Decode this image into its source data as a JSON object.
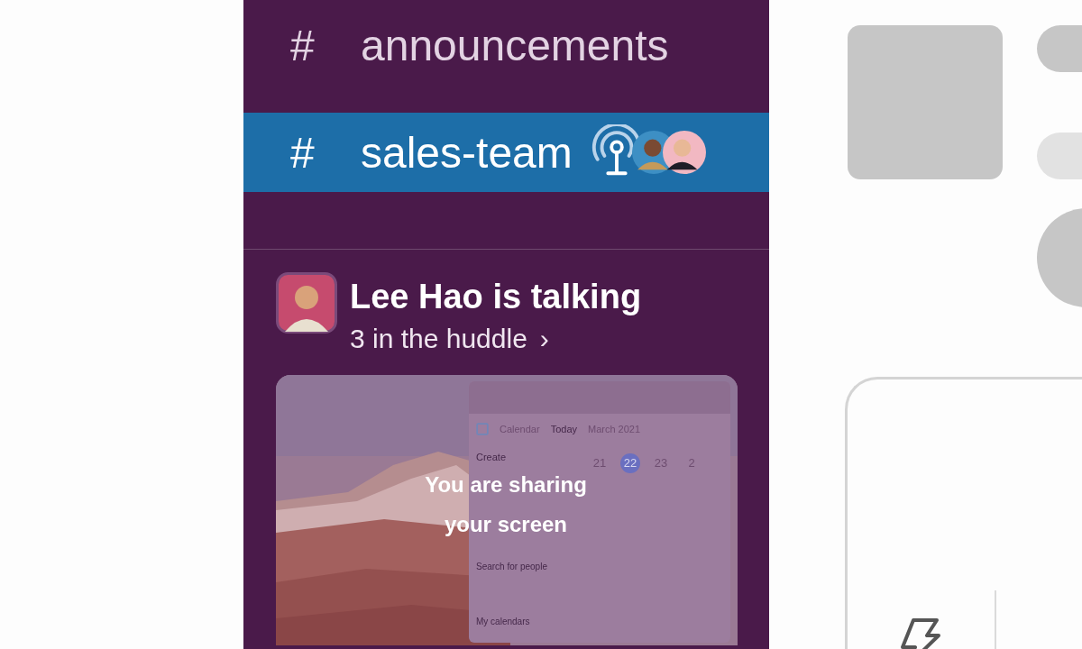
{
  "channels": [
    {
      "prefix": "#",
      "name": "announcements",
      "selected": false,
      "huddle": false
    },
    {
      "prefix": "#",
      "name": "sales-team",
      "selected": true,
      "huddle": true
    }
  ],
  "huddle": {
    "speaker": "Lee Hao is talking",
    "participants": "3 in the huddle",
    "chevron": "›",
    "screen_share": {
      "message": "You are sharing your screen",
      "shared_window": {
        "app": "Calendar",
        "today": "Today",
        "month": "March 2021",
        "create": "Create",
        "days": [
          {
            "label": "21",
            "selected": false
          },
          {
            "label": "22",
            "selected": true
          },
          {
            "label": "23",
            "selected": false
          },
          {
            "label": "2",
            "selected": false
          }
        ],
        "search_placeholder": "Search for people",
        "section": "My calendars"
      }
    }
  }
}
